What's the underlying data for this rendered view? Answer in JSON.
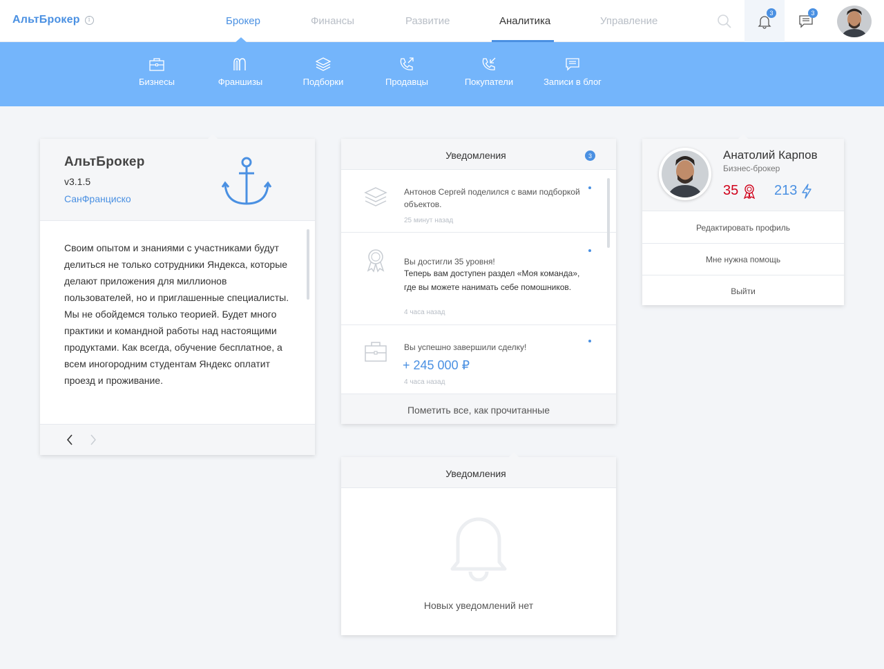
{
  "app": {
    "title": "АльтБрокер"
  },
  "nav": {
    "items": [
      {
        "label": "Брокер"
      },
      {
        "label": "Финансы"
      },
      {
        "label": "Развитие"
      },
      {
        "label": "Аналитика"
      },
      {
        "label": "Управление"
      }
    ]
  },
  "header": {
    "notifications_count": "3",
    "messages_count": "3"
  },
  "subnav": {
    "items": [
      {
        "label": "Бизнесы",
        "icon": "briefcase-icon"
      },
      {
        "label": "Франшизы",
        "icon": "franchise-icon"
      },
      {
        "label": "Подборки",
        "icon": "layers-icon"
      },
      {
        "label": "Продавцы",
        "icon": "phone-outgoing-icon"
      },
      {
        "label": "Покупатели",
        "icon": "phone-incoming-icon"
      },
      {
        "label": "Записи в блог",
        "icon": "message-icon"
      }
    ]
  },
  "about_card": {
    "title": "АльтБрокер",
    "version": "v3.1.5",
    "city": "СанФранциско",
    "text": "Своим опытом и знаниями с участниками будут делиться не только сотрудники Яндекса, которые делают приложения для миллионов пользователей, но и приглашенные специалисты. Мы не обойдемся только теорией. Будет много практики и командной работы над настоящими продуктами. Как всегда, обучение бесплатное, а всем иногородним студентам Яндекс оплатит проезд и проживание."
  },
  "notifications": {
    "title": "Уведомления",
    "count": "3",
    "items": [
      {
        "text": "Антонов Сергей поделился с вами подборкой объектов.",
        "time": "25 минут назад"
      },
      {
        "text": "Вы достигли 35 уровня!",
        "text2": "Теперь вам доступен раздел «Моя команда», где вы можете нанимать себе помошников.",
        "time": "4 часа назад"
      },
      {
        "text": "Вы успешно завершили сделку!",
        "amount": "+ 245 000 ₽",
        "time": "4 часа назад"
      }
    ],
    "mark_all": "Пометить все, как прочитанные"
  },
  "profile": {
    "name": "Анатолий Карпов",
    "role": "Бизнес-брокер",
    "level": "35",
    "points": "213",
    "menu": [
      {
        "label": "Редактировать профиль"
      },
      {
        "label": "Мне нужна помощь"
      },
      {
        "label": "Выйти"
      }
    ]
  },
  "empty_notifications": {
    "title": "Уведомления",
    "text": "Новых уведомлений нет"
  },
  "colors": {
    "accent": "#4a90e2",
    "subnav_bg": "#74b5fb",
    "level_red": "#d0021b"
  }
}
